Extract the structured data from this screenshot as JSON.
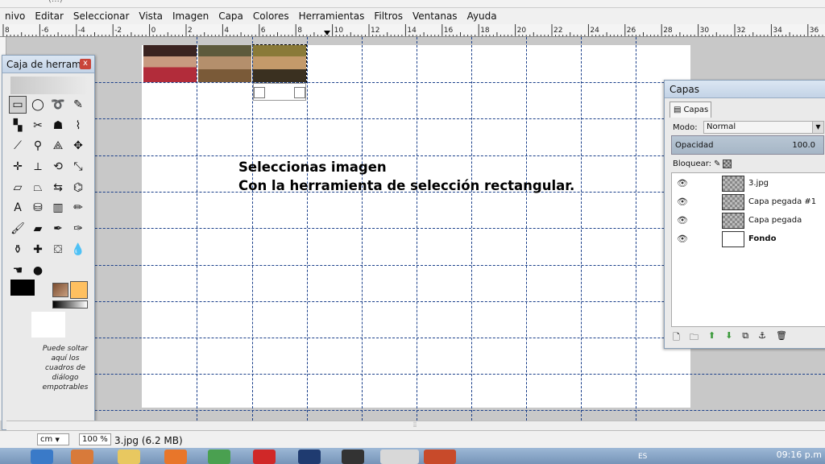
{
  "window": {
    "top_strip_text": "(…)",
    "file_info": "3.jpg (6.2 MB)"
  },
  "menubar": [
    "nivo",
    "Editar",
    "Seleccionar",
    "Vista",
    "Imagen",
    "Capa",
    "Colores",
    "Herramientas",
    "Filtros",
    "Ventanas",
    "Ayuda"
  ],
  "ruler": {
    "labels": [
      "8",
      "-6",
      "-4",
      "-2",
      "0",
      "2",
      "4",
      "6",
      "8",
      "10",
      "12",
      "14",
      "16",
      "18",
      "20",
      "22",
      "24",
      "26",
      "28",
      "30",
      "32",
      "34",
      "36"
    ]
  },
  "canvas": {
    "overlay_line1": "Seleccionas imagen",
    "overlay_line2": "Con la herramienta de selección rectangular."
  },
  "toolbox": {
    "title": "Caja de herram…",
    "close": "x",
    "drop_hint": "Puede soltar aquí los cuadros de diálogo empotrables",
    "tools": [
      {
        "name": "rect-select-icon",
        "glyph": "▭"
      },
      {
        "name": "ellipse-select-icon",
        "glyph": "◯"
      },
      {
        "name": "free-select-icon",
        "glyph": "➰"
      },
      {
        "name": "fuzzy-select-icon",
        "glyph": "✎"
      },
      {
        "name": "color-select-icon",
        "glyph": "▚"
      },
      {
        "name": "scissors-icon",
        "glyph": "✂"
      },
      {
        "name": "foreground-select-icon",
        "glyph": "☗"
      },
      {
        "name": "paths-icon",
        "glyph": "⌇"
      },
      {
        "name": "color-picker-icon",
        "glyph": "⟋"
      },
      {
        "name": "zoom-icon",
        "glyph": "⚲"
      },
      {
        "name": "measure-icon",
        "glyph": "⟁"
      },
      {
        "name": "move-icon",
        "glyph": "✥"
      },
      {
        "name": "align-icon",
        "glyph": "✛"
      },
      {
        "name": "crop-icon",
        "glyph": "⟂"
      },
      {
        "name": "rotate-icon",
        "glyph": "⟲"
      },
      {
        "name": "scale-icon",
        "glyph": "⤡"
      },
      {
        "name": "shear-icon",
        "glyph": "▱"
      },
      {
        "name": "perspective-icon",
        "glyph": "⏢"
      },
      {
        "name": "flip-icon",
        "glyph": "⇆"
      },
      {
        "name": "cage-icon",
        "glyph": "⌬"
      },
      {
        "name": "text-icon",
        "glyph": "A"
      },
      {
        "name": "bucket-fill-icon",
        "glyph": "⛁"
      },
      {
        "name": "blend-icon",
        "glyph": "▥"
      },
      {
        "name": "pencil-icon",
        "glyph": "✏"
      },
      {
        "name": "paintbrush-icon",
        "glyph": "🖌"
      },
      {
        "name": "eraser-icon",
        "glyph": "▰"
      },
      {
        "name": "airbrush-icon",
        "glyph": "✒"
      },
      {
        "name": "ink-icon",
        "glyph": "✑"
      },
      {
        "name": "clone-icon",
        "glyph": "⚱"
      },
      {
        "name": "heal-icon",
        "glyph": "✚"
      },
      {
        "name": "perspective-clone-icon",
        "glyph": "⛋"
      },
      {
        "name": "blur-icon",
        "glyph": "💧"
      },
      {
        "name": "smudge-icon",
        "glyph": "☚"
      },
      {
        "name": "dodge-burn-icon",
        "glyph": "●"
      }
    ]
  },
  "layers_panel": {
    "title": "Capas",
    "tab": "Capas",
    "mode_label": "Modo:",
    "mode_value": "Normal",
    "opacity_label": "Opacidad",
    "opacity_value": "100.0",
    "lock_label": "Bloquear:",
    "layers": [
      {
        "name": "3.jpg",
        "bold": false
      },
      {
        "name": "Capa pegada #1",
        "bold": false
      },
      {
        "name": "Capa pegada",
        "bold": false
      },
      {
        "name": "Fondo",
        "bold": true
      }
    ]
  },
  "statusbar": {
    "unit": "cm",
    "zoom": "100 %"
  },
  "taskbar": {
    "lang": "ES",
    "clock": "09:16 p.m"
  }
}
